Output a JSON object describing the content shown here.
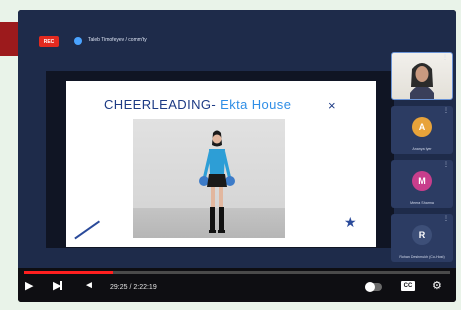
{
  "meeting": {
    "rec_badge": "REC",
    "title": "Taleb Timofeyev / comm'ty"
  },
  "slide": {
    "title_main": "CHEERLEADING- ",
    "title_accent": "Ekta House",
    "close_glyph": "×"
  },
  "participants": [
    {
      "type": "video",
      "name": ""
    },
    {
      "type": "avatar",
      "name": "Ananya Iyer",
      "initial": "A",
      "color": "#e8a33a"
    },
    {
      "type": "avatar",
      "name": "Meera Sharma",
      "initial": "M",
      "color": "#c83e8c"
    },
    {
      "type": "avatar",
      "name": "Rohan Deshmukh (Co-Host)",
      "initial": "R",
      "color": "#3d4f78"
    }
  ],
  "player": {
    "time_text": "29:25 / 2:22:19",
    "progress_fraction": 0.21,
    "icons": [
      "play-icon",
      "next-icon",
      "volume-icon",
      "autoplay-toggle",
      "captions-icon",
      "settings-icon"
    ],
    "captions_label": "CC"
  },
  "colors": {
    "accent_red": "#ff1f1f",
    "meeting_bg": "#1e2b4a",
    "slide_title": "#1c3a84",
    "slide_accent": "#2f8ee6"
  }
}
